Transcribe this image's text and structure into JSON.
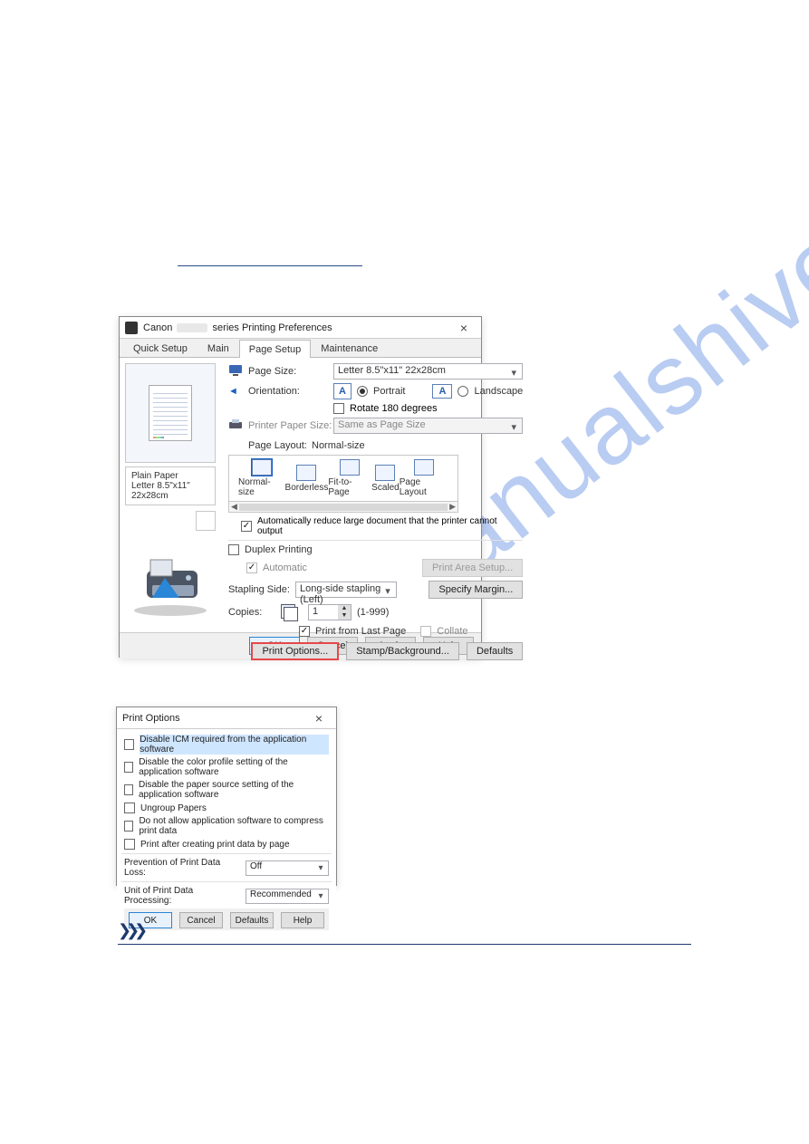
{
  "watermark": "manualshive.com",
  "dlg1": {
    "title_prefix": "Canon",
    "title_suffix": "series Printing Preferences",
    "tabs": [
      "Quick Setup",
      "Main",
      "Page Setup",
      "Maintenance"
    ],
    "active_tab": 2,
    "paper": {
      "name": "Plain Paper",
      "size": "Letter 8.5\"x11\" 22x28cm"
    },
    "page_size": {
      "label": "Page Size:",
      "value": "Letter 8.5\"x11\" 22x28cm"
    },
    "orientation": {
      "label": "Orientation:",
      "portrait": "Portrait",
      "landscape": "Landscape",
      "selected": "portrait"
    },
    "rotate": "Rotate 180 degrees",
    "printer_paper": {
      "label": "Printer Paper Size:",
      "value": "Same as Page Size"
    },
    "page_layout": {
      "label": "Page Layout:",
      "value": "Normal-size",
      "items": [
        "Normal-size",
        "Borderless",
        "Fit-to-Page",
        "Scaled",
        "Page Layout"
      ]
    },
    "auto_reduce": "Automatically reduce large document that the printer cannot output",
    "duplex": {
      "label": "Duplex Printing",
      "auto": "Automatic"
    },
    "print_area_btn": "Print Area Setup...",
    "stapling": {
      "label": "Stapling Side:",
      "value": "Long-side stapling (Left)",
      "margin_btn": "Specify Margin..."
    },
    "copies": {
      "label": "Copies:",
      "value": "1",
      "range": "(1-999)",
      "last_page": "Print from Last Page",
      "collate": "Collate"
    },
    "action_btns": {
      "print_options": "Print Options...",
      "stamp": "Stamp/Background...",
      "defaults": "Defaults"
    },
    "bottom_btns": {
      "ok": "OK",
      "cancel": "Cancel",
      "apply": "Apply",
      "help": "Help"
    }
  },
  "dlg2": {
    "title": "Print Options",
    "options": [
      "Disable ICM required from the application software",
      "Disable the color profile setting of the application software",
      "Disable the paper source setting of the application software",
      "Ungroup Papers",
      "Do not allow application software to compress print data",
      "Print after creating print data by page"
    ],
    "highlight_index": 0,
    "prevention": {
      "label": "Prevention of Print Data Loss:",
      "value": "Off"
    },
    "unit": {
      "label": "Unit of Print Data Processing:",
      "value": "Recommended"
    },
    "bottom_btns": {
      "ok": "OK",
      "cancel": "Cancel",
      "defaults": "Defaults",
      "help": "Help"
    }
  }
}
